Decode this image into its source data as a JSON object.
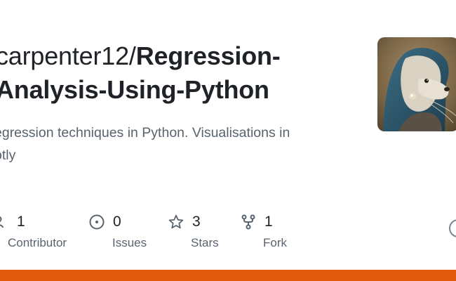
{
  "repo": {
    "owner": "carpenter12/",
    "name_line1": "Regression-",
    "name_line2": "Analysis-Using-Python",
    "description_line1": "egression techniques in Python. Visualisations in",
    "description_line2": "otly"
  },
  "stats": [
    {
      "icon": "people-icon",
      "count": "1",
      "label": "Contributor"
    },
    {
      "icon": "issue-icon",
      "count": "0",
      "label": "Issues"
    },
    {
      "icon": "star-icon",
      "count": "3",
      "label": "Stars"
    },
    {
      "icon": "fork-icon",
      "count": "1",
      "label": "Fork"
    }
  ],
  "colors": {
    "accent_bar": "#e15b0f",
    "text_primary": "#1f2328",
    "text_muted": "#59636e"
  }
}
